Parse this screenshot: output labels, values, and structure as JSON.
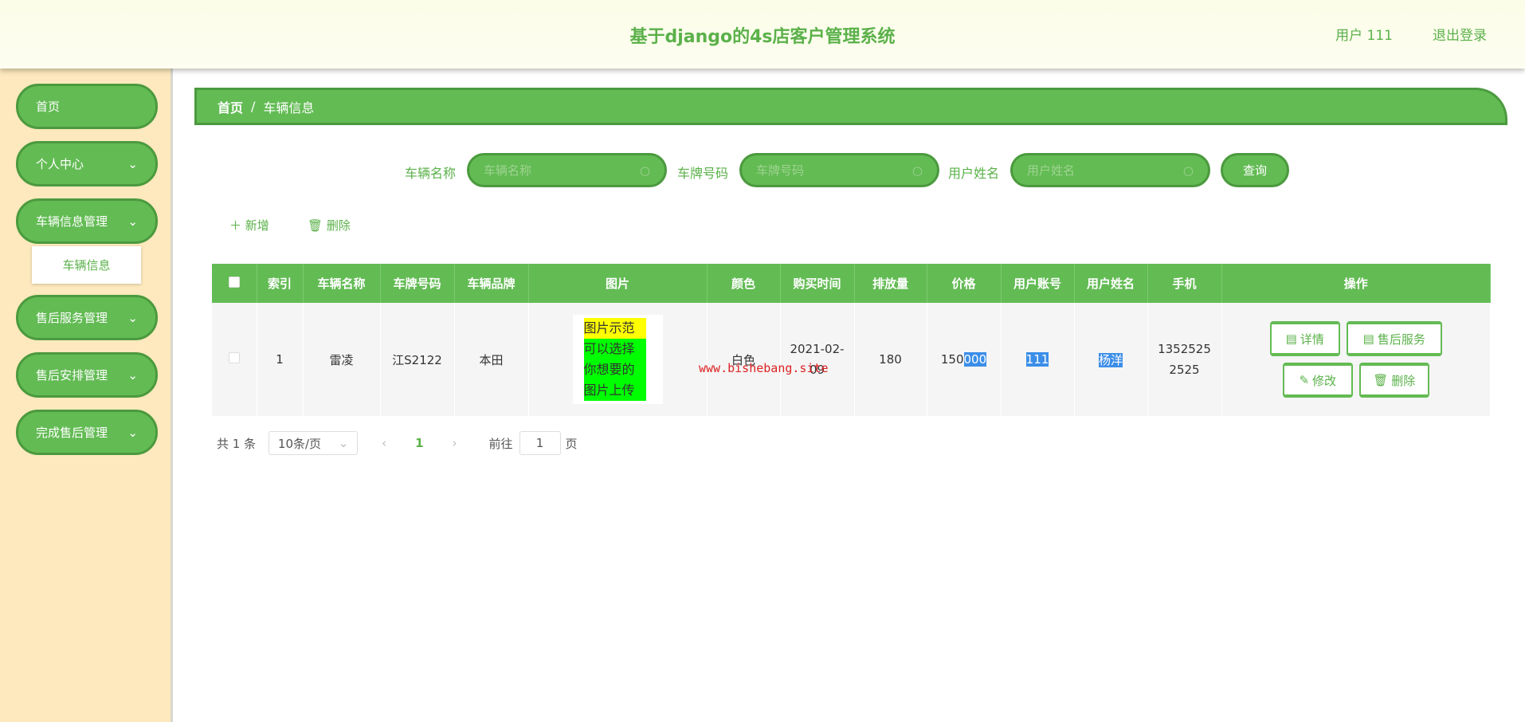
{
  "header": {
    "title": "基于django的4s店客户管理系统",
    "user": "用户 111",
    "logout": "退出登录"
  },
  "sidebar": {
    "items": [
      {
        "label": "首页"
      },
      {
        "label": "个人中心"
      },
      {
        "label": "车辆信息管理"
      },
      {
        "label": "售后服务管理"
      },
      {
        "label": "售后安排管理"
      },
      {
        "label": "完成售后管理"
      }
    ],
    "sub": "车辆信息",
    "chevron": "⌄"
  },
  "breadcrumb": {
    "home": "首页",
    "sep": "/",
    "current": "车辆信息"
  },
  "search": {
    "fields": [
      {
        "label": "车辆名称",
        "placeholder": "车辆名称"
      },
      {
        "label": "车牌号码",
        "placeholder": "车牌号码"
      },
      {
        "label": "用户姓名",
        "placeholder": "用户姓名"
      }
    ],
    "button": "查询"
  },
  "actions": {
    "add": "新增",
    "delete": "删除"
  },
  "table": {
    "headers": [
      "索引",
      "车辆名称",
      "车牌号码",
      "车辆品牌",
      "图片",
      "颜色",
      "购买时间",
      "排放量",
      "价格",
      "用户账号",
      "用户姓名",
      "手机",
      "操作"
    ],
    "rows": [
      {
        "index": "1",
        "name": "雷凌",
        "plate": "江S2122",
        "brand": "本田",
        "image_lines": [
          "图片示范",
          "可以选择",
          "你想要的",
          "图片上传"
        ],
        "color": "白色",
        "date": "2021-02-09",
        "displacement": "180",
        "price_a": "150",
        "price_b": "000",
        "account": "111",
        "username": "杨洋",
        "phone": "13525252525"
      }
    ],
    "buttons": {
      "detail": "详情",
      "service": "售后服务",
      "edit": "修改",
      "delete": "删除"
    }
  },
  "watermark": "www.bishebang.site",
  "pagination": {
    "total": "共 1 条",
    "page_size": "10条/页",
    "current": "1",
    "goto": "前往",
    "goto_value": "1",
    "page_unit": "页"
  }
}
